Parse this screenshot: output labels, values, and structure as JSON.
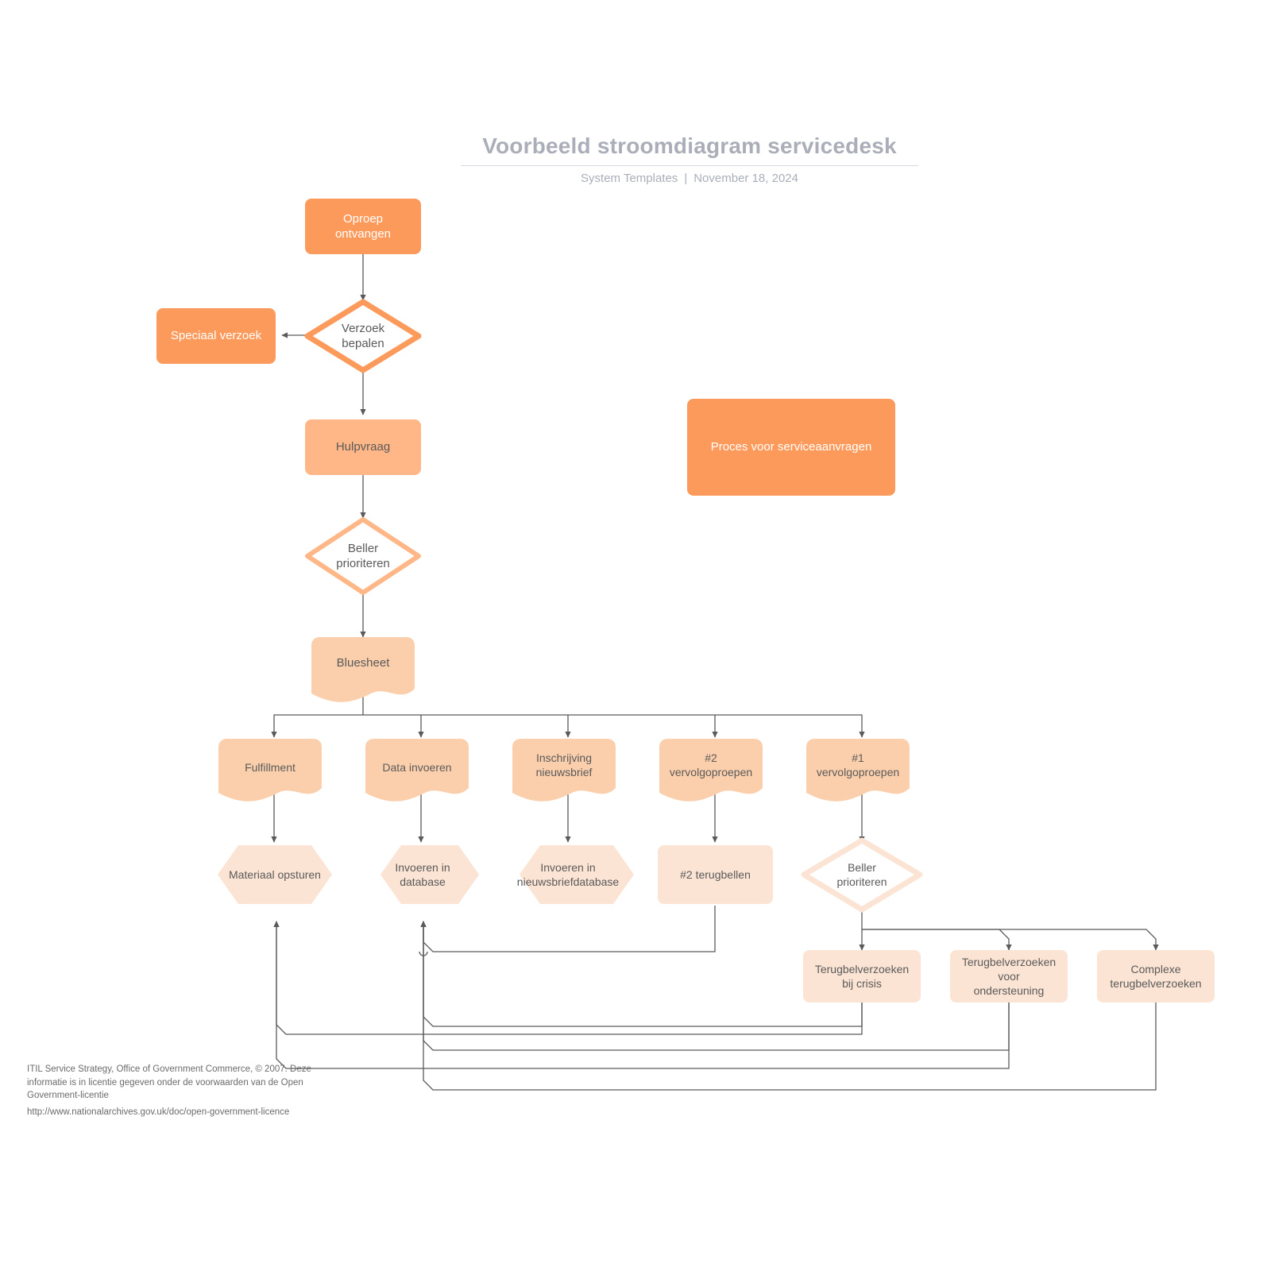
{
  "header": {
    "title": "Voorbeeld stroomdiagram servicedesk",
    "source": "System Templates",
    "separator": "|",
    "date": "November 18, 2024"
  },
  "legend": {
    "label": "Proces voor serviceaanvragen"
  },
  "footer": {
    "line1": "ITIL Service Strategy, Office of Government Commerce, © 2007. Deze informatie is in licentie gegeven onder de voorwaarden van de Open Government-licentie",
    "url": "http://www.nationalarchives.gov.uk/doc/open-government-licence"
  },
  "colors": {
    "dark_orange": "#FB9A5B",
    "mid_orange": "#FFB787",
    "doc_orange": "#FBCFAC",
    "pale_orange": "#FCE4D4",
    "connector": "#5a5a5a",
    "title_gray": "#a9aeb9",
    "text_gray": "#5a5a5a"
  },
  "nodes": [
    {
      "id": "oproep",
      "label": "Oproep\nontvangen",
      "shape": "rect",
      "tone": "dark"
    },
    {
      "id": "verzoek",
      "label": "Verzoek\nbepalen",
      "shape": "diamond",
      "tone": "dark"
    },
    {
      "id": "speciaal",
      "label": "Speciaal verzoek",
      "shape": "rect",
      "tone": "dark"
    },
    {
      "id": "hulpvraag",
      "label": "Hulpvraag",
      "shape": "rect",
      "tone": "mid"
    },
    {
      "id": "beller1",
      "label": "Beller\nprioriteren",
      "shape": "diamond",
      "tone": "mid"
    },
    {
      "id": "bluesheet",
      "label": "Bluesheet",
      "shape": "document",
      "tone": "doc"
    },
    {
      "id": "fulfillment",
      "label": "Fulfillment",
      "shape": "document",
      "tone": "doc"
    },
    {
      "id": "data",
      "label": "Data invoeren",
      "shape": "document",
      "tone": "doc"
    },
    {
      "id": "inschrijving",
      "label": "Inschrijving\nnieuwsbrief",
      "shape": "document",
      "tone": "doc"
    },
    {
      "id": "vervolg2",
      "label": "#2\nvervolgoproepen",
      "shape": "document",
      "tone": "doc"
    },
    {
      "id": "vervolg1",
      "label": "#1\nvervolgoproepen",
      "shape": "document",
      "tone": "doc"
    },
    {
      "id": "materiaal",
      "label": "Materiaal opsturen",
      "shape": "hexagon",
      "tone": "pale"
    },
    {
      "id": "invoerendb",
      "label": "Invoeren in\ndatabase",
      "shape": "hexagon",
      "tone": "pale"
    },
    {
      "id": "invoerennb",
      "label": "Invoeren in\nnieuwsbriefdatabase",
      "shape": "hexagon",
      "tone": "pale"
    },
    {
      "id": "terugbellen2",
      "label": "#2 terugbellen",
      "shape": "rect",
      "tone": "pale"
    },
    {
      "id": "beller2",
      "label": "Beller\nprioriteren",
      "shape": "diamond",
      "tone": "pale"
    },
    {
      "id": "crisis",
      "label": "Terugbelverzoeken\nbij crisis",
      "shape": "rect",
      "tone": "pale"
    },
    {
      "id": "ondersteuning",
      "label": "Terugbelverzoeken\nvoor\nondersteuning",
      "shape": "rect",
      "tone": "pale"
    },
    {
      "id": "complexe",
      "label": "Complexe\nterugbelverzoeken",
      "shape": "rect",
      "tone": "pale"
    }
  ],
  "edges": [
    {
      "from": "oproep",
      "to": "verzoek"
    },
    {
      "from": "verzoek",
      "to": "speciaal"
    },
    {
      "from": "verzoek",
      "to": "hulpvraag"
    },
    {
      "from": "hulpvraag",
      "to": "beller1"
    },
    {
      "from": "beller1",
      "to": "bluesheet"
    },
    {
      "from": "bluesheet",
      "to": "fulfillment"
    },
    {
      "from": "bluesheet",
      "to": "data"
    },
    {
      "from": "bluesheet",
      "to": "inschrijving"
    },
    {
      "from": "bluesheet",
      "to": "vervolg2"
    },
    {
      "from": "bluesheet",
      "to": "vervolg1"
    },
    {
      "from": "fulfillment",
      "to": "materiaal"
    },
    {
      "from": "data",
      "to": "invoerendb"
    },
    {
      "from": "inschrijving",
      "to": "invoerennb"
    },
    {
      "from": "vervolg2",
      "to": "terugbellen2"
    },
    {
      "from": "vervolg1",
      "to": "beller2"
    },
    {
      "from": "beller2",
      "to": "crisis"
    },
    {
      "from": "beller2",
      "to": "ondersteuning"
    },
    {
      "from": "beller2",
      "to": "complexe"
    },
    {
      "from": "terugbellen2",
      "to": "invoerendb"
    },
    {
      "from": "crisis",
      "to": "materiaal"
    },
    {
      "from": "crisis",
      "to": "invoerendb"
    },
    {
      "from": "ondersteuning",
      "to": "materiaal"
    },
    {
      "from": "ondersteuning",
      "to": "invoerendb"
    },
    {
      "from": "complexe",
      "to": "invoerendb"
    }
  ]
}
